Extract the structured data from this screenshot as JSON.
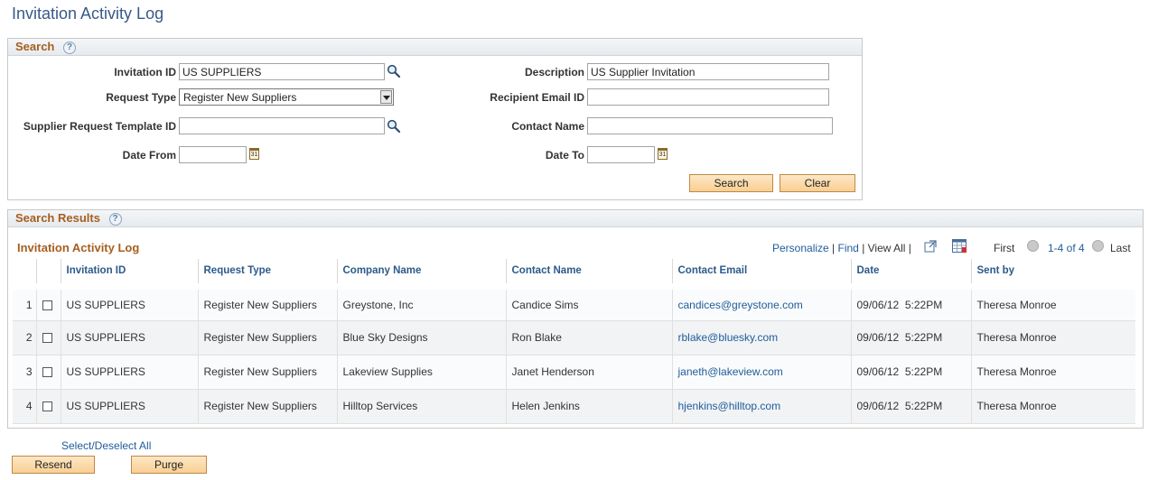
{
  "page": {
    "title": "Invitation Activity Log"
  },
  "search": {
    "header": "Search",
    "fields": {
      "invitation_id": {
        "label": "Invitation ID",
        "value": "US SUPPLIERS"
      },
      "request_type": {
        "label": "Request Type",
        "value": "Register New Suppliers"
      },
      "template_id": {
        "label": "Supplier Request Template ID",
        "value": ""
      },
      "date_from": {
        "label": "Date From",
        "value": ""
      },
      "description": {
        "label": "Description",
        "value": "US Supplier Invitation"
      },
      "recipient_email": {
        "label": "Recipient Email ID",
        "value": ""
      },
      "contact_name": {
        "label": "Contact Name",
        "value": ""
      },
      "date_to": {
        "label": "Date To",
        "value": ""
      }
    },
    "search_button": "Search",
    "clear_button": "Clear"
  },
  "results": {
    "header": "Search Results",
    "grid_title": "Invitation Activity Log",
    "nav": {
      "personalize": "Personalize",
      "find": "Find",
      "view_all": "View All",
      "first": "First",
      "range": "1-4 of 4",
      "last": "Last"
    },
    "columns": [
      "Invitation ID",
      "Request Type",
      "Company Name",
      "Contact Name",
      "Contact Email",
      "Date",
      "Sent by"
    ],
    "rows": [
      {
        "num": "1",
        "invitation_id": "US SUPPLIERS",
        "request_type": "Register New Suppliers",
        "company": "Greystone, Inc",
        "contact": "Candice Sims",
        "email": "candices@greystone.com",
        "date": "09/06/12  5:22PM",
        "sent_by": "Theresa Monroe"
      },
      {
        "num": "2",
        "invitation_id": "US SUPPLIERS",
        "request_type": "Register New Suppliers",
        "company": "Blue Sky Designs",
        "contact": "Ron Blake",
        "email": "rblake@bluesky.com",
        "date": "09/06/12  5:22PM",
        "sent_by": "Theresa Monroe"
      },
      {
        "num": "3",
        "invitation_id": "US SUPPLIERS",
        "request_type": "Register New Suppliers",
        "company": "Lakeview Supplies",
        "contact": "Janet Henderson",
        "email": "janeth@lakeview.com",
        "date": "09/06/12  5:22PM",
        "sent_by": "Theresa Monroe"
      },
      {
        "num": "4",
        "invitation_id": "US SUPPLIERS",
        "request_type": "Register New Suppliers",
        "company": "Hilltop Services",
        "contact": "Helen Jenkins",
        "email": "hjenkins@hilltop.com",
        "date": "09/06/12  5:22PM",
        "sent_by": "Theresa Monroe"
      }
    ]
  },
  "actions": {
    "select_all": "Select/Deselect All",
    "resend": "Resend",
    "purge": "Purge"
  },
  "icons": {
    "help": "?",
    "calendar": "31"
  },
  "colors": {
    "accent_orange": "#a65e1e",
    "link_blue": "#1f5c99",
    "title_blue": "#375a87",
    "button_fill": "#f9cf92"
  }
}
